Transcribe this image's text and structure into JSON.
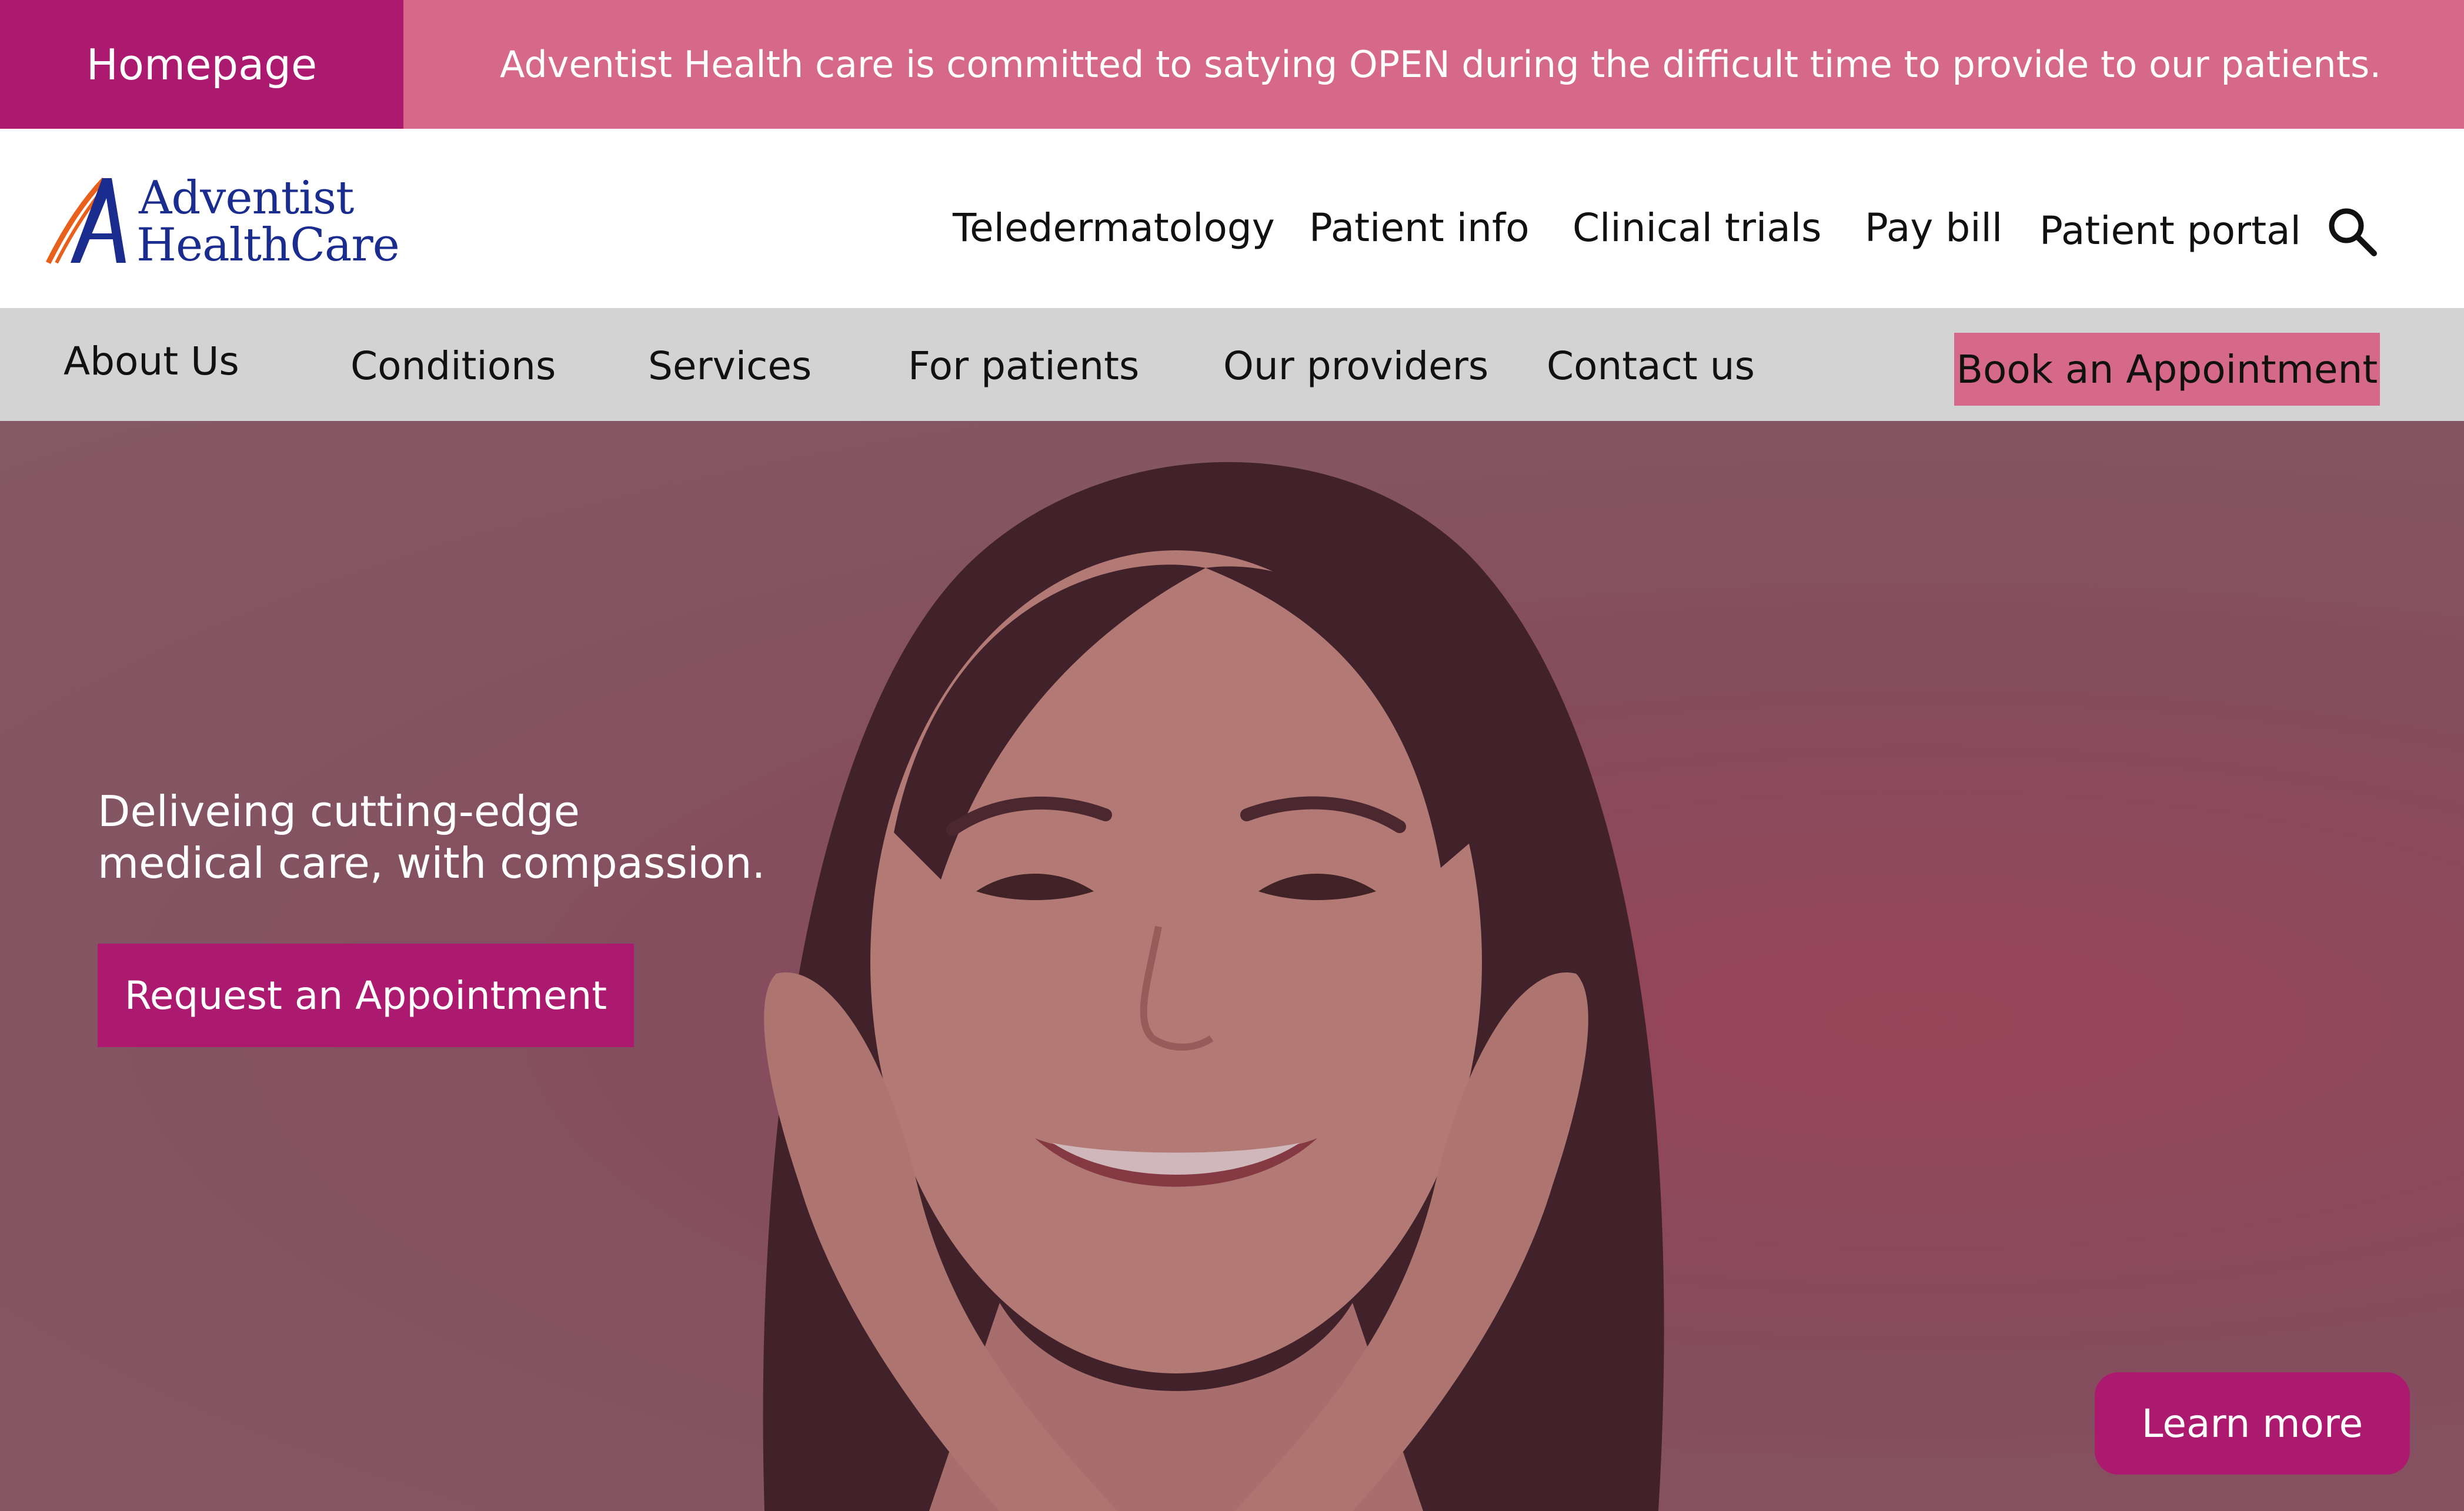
{
  "top_bar": {
    "home_label": "Homepage",
    "announcement": "Adventist Health care is committed to satying OPEN during the difficult time to provide to our patients."
  },
  "header": {
    "logo_line1": "Adventist",
    "logo_line2": "HealthCare",
    "utility_links": [
      "Teledermatology",
      "Patient info",
      "Clinical trials",
      "Pay bill",
      "Patient portal"
    ],
    "search_icon": "search-icon"
  },
  "main_nav": {
    "items": [
      "About Us",
      "Conditions",
      "Services",
      "For patients",
      "Our providers",
      "Contact us"
    ],
    "cta_label": "Book an Appointment"
  },
  "hero": {
    "tagline_line1": "Deliveing cutting-edge",
    "tagline_line2": "medical care, with compassion.",
    "request_label": "Request an Appointment",
    "learn_more_label": "Learn more"
  },
  "colors": {
    "accent": "#ac1a70",
    "pink": "#d6698a",
    "nav_gray": "#d3d3d3",
    "logo_blue": "#1b2c8f"
  }
}
